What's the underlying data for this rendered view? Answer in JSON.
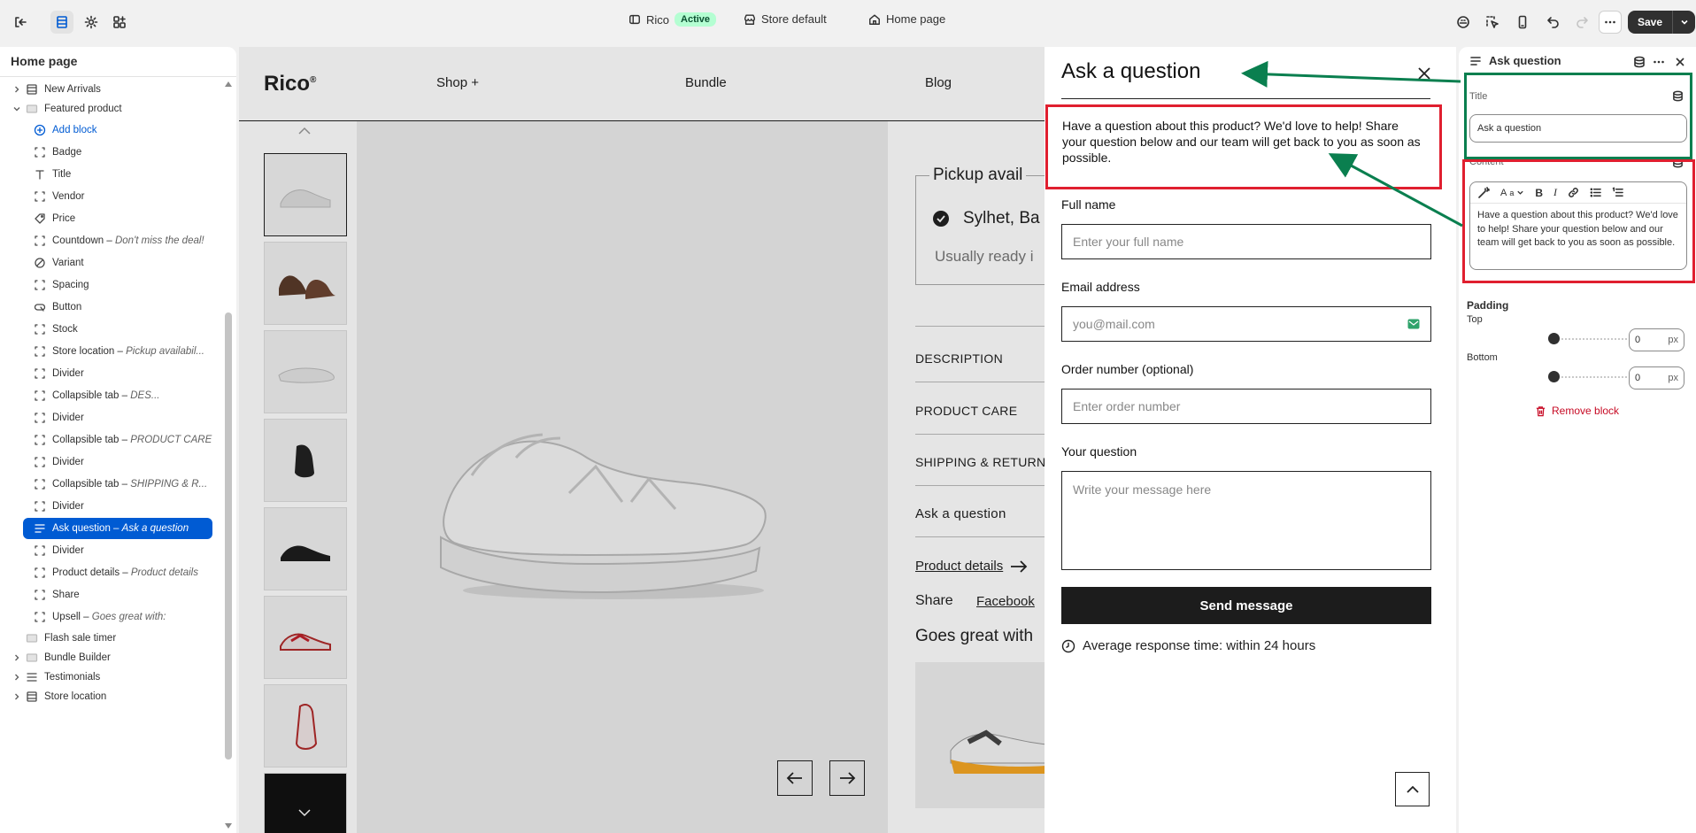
{
  "topbar": {
    "store_name": "Rico",
    "status_badge": "Active",
    "store_default": "Store default",
    "page_name": "Home page",
    "save_label": "Save"
  },
  "left": {
    "title": "Home page",
    "rows": [
      {
        "label": "New Arrivals",
        "note": "",
        "icon": "section-icon",
        "level": 0,
        "chevron": true
      },
      {
        "label": "Featured product",
        "note": "",
        "icon": "image-section-icon",
        "level": 0,
        "chevron": true
      },
      {
        "label": "Add block",
        "note": "",
        "icon": "plus-circle-icon",
        "level": 1
      },
      {
        "label": "Badge",
        "note": "",
        "icon": "block-icon",
        "level": 1
      },
      {
        "label": "Title",
        "note": "",
        "icon": "text-icon",
        "level": 1
      },
      {
        "label": "Vendor",
        "note": "",
        "icon": "block-icon",
        "level": 1
      },
      {
        "label": "Price",
        "note": "",
        "icon": "price-icon",
        "level": 1
      },
      {
        "label": "Countdown",
        "note": "Don't miss the deal!",
        "icon": "block-icon",
        "level": 1
      },
      {
        "label": "Variant",
        "note": "",
        "icon": "variant-icon",
        "level": 1
      },
      {
        "label": "Spacing",
        "note": "",
        "icon": "block-icon",
        "level": 1
      },
      {
        "label": "Button",
        "note": "",
        "icon": "button-icon",
        "level": 1
      },
      {
        "label": "Stock",
        "note": "",
        "icon": "block-icon",
        "level": 1
      },
      {
        "label": "Store location",
        "note": "Pickup availabil...",
        "icon": "block-icon",
        "level": 1
      },
      {
        "label": "Divider",
        "note": "",
        "icon": "block-icon",
        "level": 1
      },
      {
        "label": "Collapsible tab",
        "note": "DES...",
        "icon": "block-icon",
        "level": 1
      },
      {
        "label": "Divider",
        "note": "",
        "icon": "block-icon",
        "level": 1
      },
      {
        "label": "Collapsible tab",
        "note": "PRODUCT CARE",
        "icon": "block-icon",
        "level": 1
      },
      {
        "label": "Divider",
        "note": "",
        "icon": "block-icon",
        "level": 1
      },
      {
        "label": "Collapsible tab",
        "note": "SHIPPING & R...",
        "icon": "block-icon",
        "level": 1
      },
      {
        "label": "Divider",
        "note": "",
        "icon": "block-icon",
        "level": 1
      },
      {
        "label": "Ask question",
        "note": "Ask a question",
        "icon": "lines-icon",
        "level": 1,
        "selected": true
      },
      {
        "label": "Divider",
        "note": "",
        "icon": "block-icon",
        "level": 1
      },
      {
        "label": "Product details",
        "note": "Product details",
        "icon": "block-icon",
        "level": 1
      },
      {
        "label": "Share",
        "note": "",
        "icon": "block-icon",
        "level": 1
      },
      {
        "label": "Upsell",
        "note": "Goes great with:",
        "icon": "block-icon",
        "level": 1
      },
      {
        "label": "Flash sale timer",
        "note": "",
        "icon": "image-section-icon",
        "level": 0
      },
      {
        "label": "Bundle Builder",
        "note": "",
        "icon": "image-section-icon",
        "level": 0,
        "chevron": true
      },
      {
        "label": "Testimonials",
        "note": "",
        "icon": "list-section-icon",
        "level": 0,
        "chevron": true
      },
      {
        "label": "Store location",
        "note": "",
        "icon": "section-icon",
        "level": 0,
        "chevron": true
      }
    ]
  },
  "preview": {
    "logo": "Rico",
    "logo_mark": "®",
    "nav": [
      "Shop +",
      "Bundle",
      "Blog"
    ],
    "pickup_title": "Pickup avail",
    "pickup_store": "Sylhet, Ba",
    "pickup_ready": "Usually ready i",
    "accordions": [
      "DESCRIPTION",
      "PRODUCT CARE",
      "SHIPPING & RETURN"
    ],
    "ask_link": "Ask a question",
    "product_details": "Product details",
    "share_label": "Share",
    "share_facebook": "Facebook",
    "upsell_title": "Goes great with"
  },
  "modal": {
    "title": "Ask a question",
    "description": "Have a question about this product? We'd love to help! Share your question below and our team will get back to you as soon as possible.",
    "full_name_label": "Full name",
    "full_name_placeholder": "Enter your full name",
    "email_label": "Email address",
    "email_placeholder": "you@mail.com",
    "order_label": "Order number (optional)",
    "order_placeholder": "Enter order number",
    "question_label": "Your question",
    "question_placeholder": "Write your message here",
    "send_label": "Send message",
    "response_time": "Average response time: within 24 hours"
  },
  "right": {
    "header": "Ask question",
    "title_label": "Title",
    "title_value": "Ask a question",
    "content_label": "Content",
    "content_value": "Have a question about this product? We'd love to help! Share your question below and our team will get back to you as soon as possible.",
    "padding_label": "Padding",
    "top_label": "Top",
    "top_value": "0",
    "bottom_label": "Bottom",
    "bottom_value": "0",
    "unit": "px",
    "remove_label": "Remove block",
    "top_level": 0,
    "bottom_level": 0
  },
  "colors": {
    "accent": "#005bd3",
    "annotation_red": "#e01f2f",
    "annotation_green": "#0a7f4f",
    "badge_bg": "#b4fed2",
    "danger": "#c70a24"
  }
}
